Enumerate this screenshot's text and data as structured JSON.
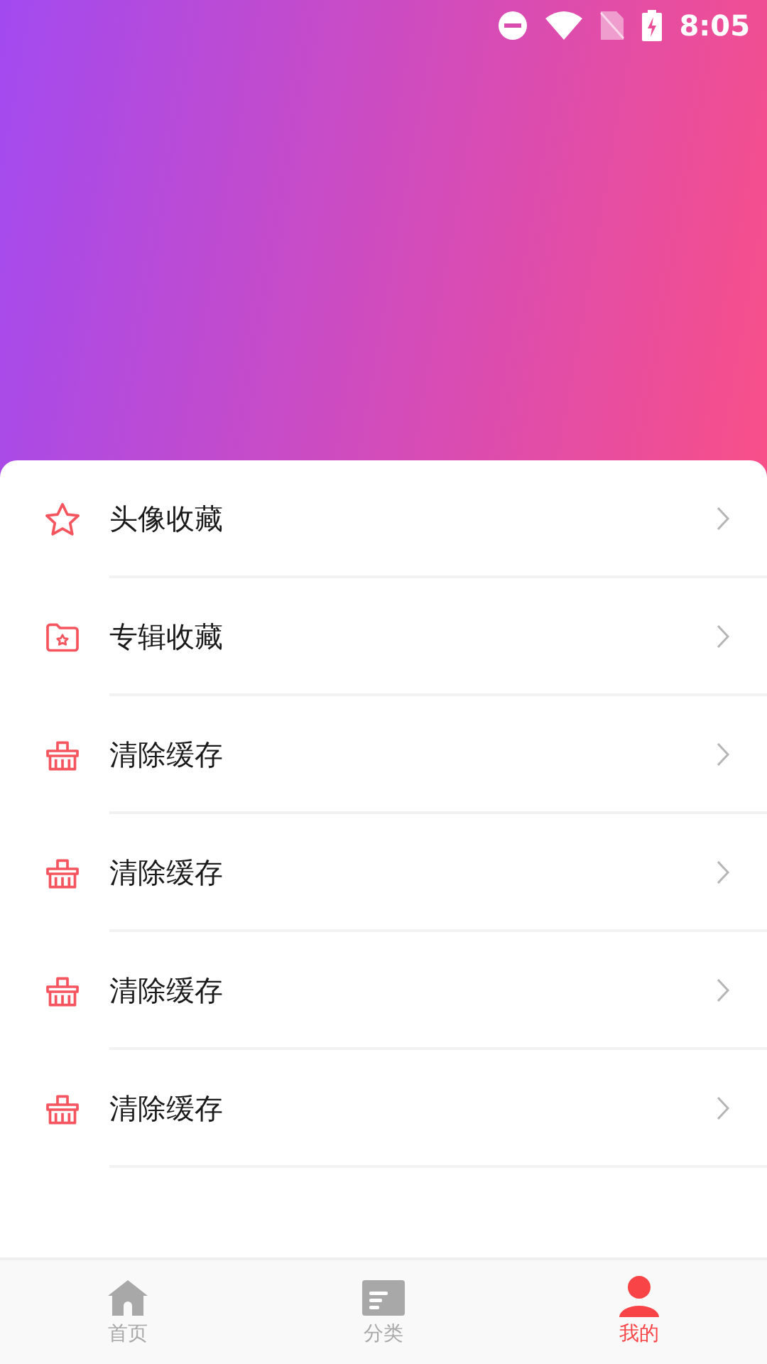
{
  "status_bar": {
    "time": "8:05"
  },
  "menu": [
    {
      "kind": "star",
      "label": "头像收藏"
    },
    {
      "kind": "folder",
      "label": "专辑收藏"
    },
    {
      "kind": "basket",
      "label": "清除缓存"
    },
    {
      "kind": "basket",
      "label": "清除缓存"
    },
    {
      "kind": "basket",
      "label": "清除缓存"
    },
    {
      "kind": "basket",
      "label": "清除缓存"
    }
  ],
  "tabs": [
    {
      "kind": "home",
      "label": "首页",
      "selected": false
    },
    {
      "kind": "category",
      "label": "分类",
      "selected": false
    },
    {
      "kind": "profile",
      "label": "我的",
      "selected": true
    }
  ]
}
